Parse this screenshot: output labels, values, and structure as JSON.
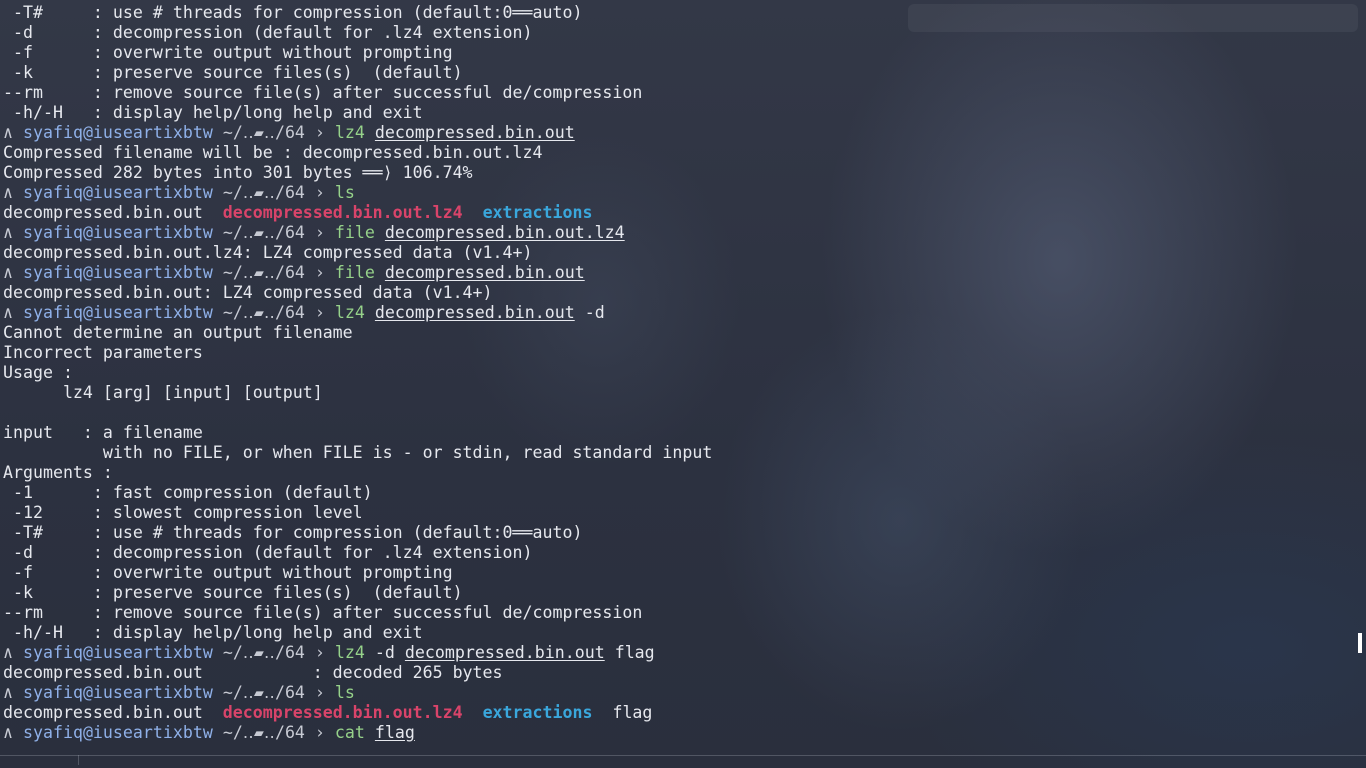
{
  "prompt": {
    "arrow": "∧",
    "user_host": "syafiq@iuseartixbtw",
    "path": "~/‥▰‥/64",
    "separator": "›"
  },
  "help_top": [
    " -T#     : use # threads for compression (default:0══auto)",
    " -d      : decompression (default for .lz4 extension)",
    " -f      : overwrite output without prompting",
    " -k      : preserve source files(s)  (default)",
    "--rm     : remove source file(s) after successful de/compression",
    " -h/-H   : display help/long help and exit"
  ],
  "cmd1": {
    "name": "lz4",
    "arg": "decompressed.bin.out"
  },
  "out1": [
    "Compressed filename will be : decompressed.bin.out.lz4",
    "Compressed 282 bytes into 301 bytes ══⟩ 106.74%"
  ],
  "cmd2": {
    "name": "ls"
  },
  "ls1": {
    "file1": "decompressed.bin.out",
    "file2": "decompressed.bin.out.lz4",
    "dir1": "extractions"
  },
  "cmd3": {
    "name": "file",
    "arg": "decompressed.bin.out.lz4"
  },
  "out3": "decompressed.bin.out.lz4: LZ4 compressed data (v1.4+)",
  "cmd4": {
    "name": "file",
    "arg": "decompressed.bin.out"
  },
  "out4": "decompressed.bin.out: LZ4 compressed data (v1.4+)",
  "cmd5": {
    "name": "lz4",
    "arg": "decompressed.bin.out",
    "flag": "-d"
  },
  "out5": [
    "Cannot determine an output filename",
    "Incorrect parameters",
    "Usage :",
    "      lz4 [arg] [input] [output]",
    "",
    "input   : a filename",
    "          with no FILE, or when FILE is - or stdin, read standard input",
    "Arguments :",
    " -1      : fast compression (default)",
    " -12     : slowest compression level",
    " -T#     : use # threads for compression (default:0══auto)",
    " -d      : decompression (default for .lz4 extension)",
    " -f      : overwrite output without prompting",
    " -k      : preserve source files(s)  (default)",
    "--rm     : remove source file(s) after successful de/compression",
    " -h/-H   : display help/long help and exit"
  ],
  "cmd6": {
    "name": "lz4",
    "flag": "-d",
    "arg": "decompressed.bin.out",
    "arg2": "flag"
  },
  "out6": "decompressed.bin.out           : decoded 265 bytes",
  "cmd7": {
    "name": "ls"
  },
  "ls2": {
    "file1": "decompressed.bin.out",
    "file2": "decompressed.bin.out.lz4",
    "dir1": "extractions",
    "file3": "flag"
  },
  "cmd8": {
    "name": "cat",
    "arg": "flag"
  },
  "colors": {
    "background": "#2f3443",
    "user": "#8fb0e8",
    "command": "#96d28a",
    "lz4_file": "#d9446a",
    "directory": "#3aa7dc",
    "text": "#e6e8ee"
  }
}
